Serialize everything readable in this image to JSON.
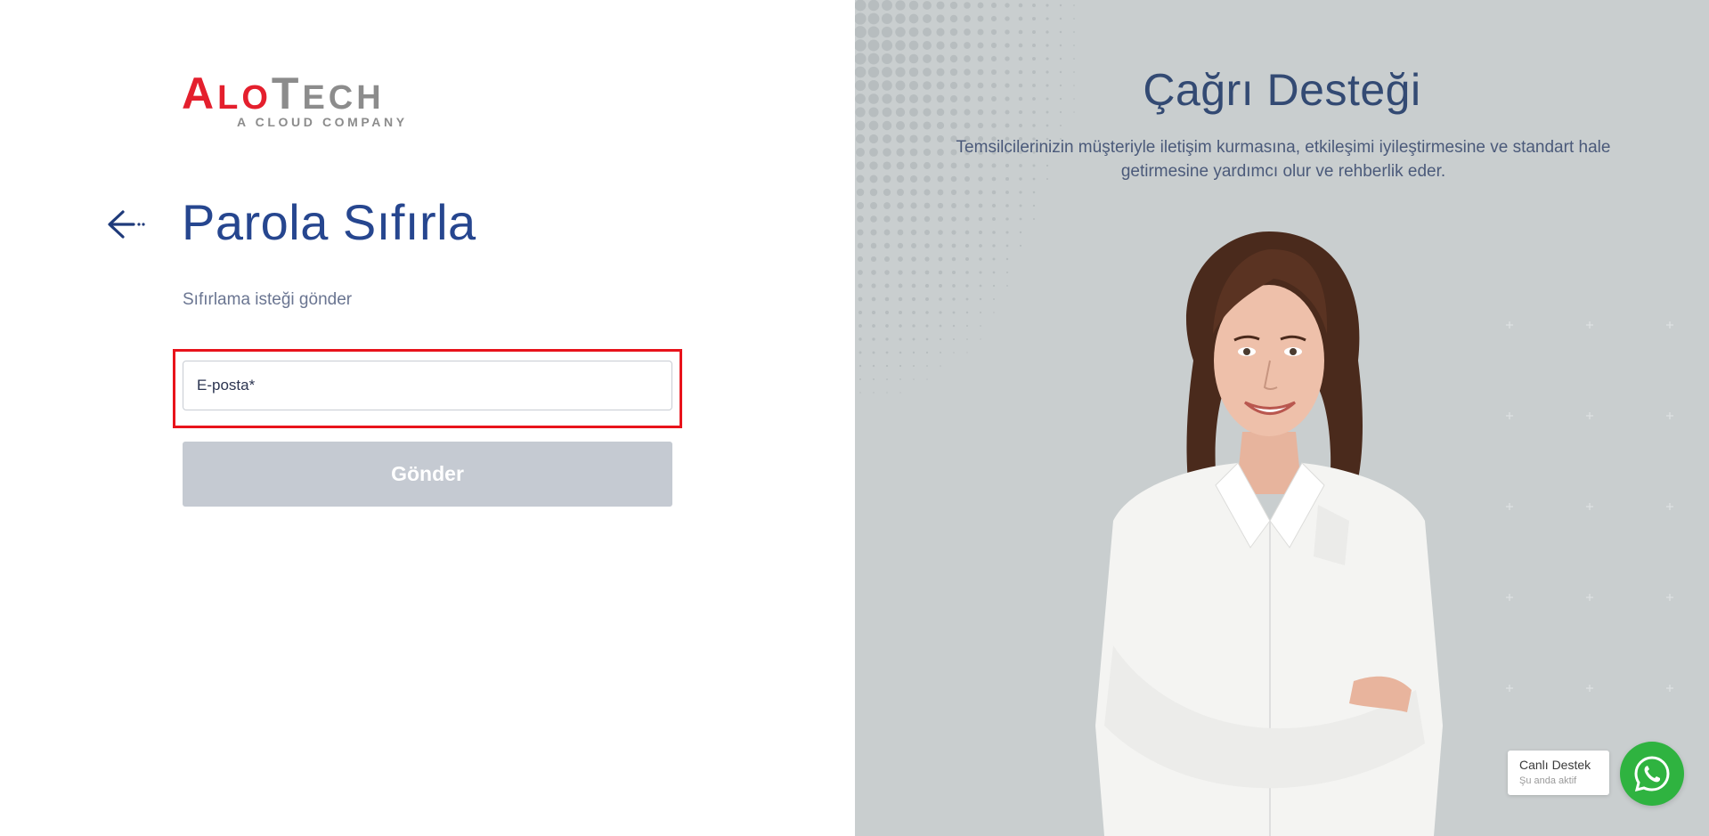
{
  "logo": {
    "main_initial_1": "A",
    "main_rest_1": "LO",
    "main_initial_2": "T",
    "main_rest_2": "ECH",
    "sub": "A CLOUD  COMPANY"
  },
  "form": {
    "title": "Parola Sıfırla",
    "subtitle": "Sıfırlama isteği gönder",
    "email_label": "E-posta*",
    "submit_label": "Gönder"
  },
  "promo": {
    "title": "Çağrı Desteği",
    "description": "Temsilcilerinizin müşteriyle iletişim kurmasına, etkileşimi iyileştirmesine ve standart hale getirmesine yardımcı olur ve rehberlik eder."
  },
  "live_chat": {
    "title": "Canlı Destek",
    "status": "Şu anda aktif"
  },
  "colors": {
    "brand_red": "#e41f2d",
    "brand_grey": "#8c8c8c",
    "title_blue": "#26468f",
    "button_disabled": "#c5cad2",
    "right_bg": "#c9cecf",
    "whatsapp_green": "#2fb340",
    "focus_ring": "#e8131b"
  },
  "icons": {
    "back": "arrow-left-icon",
    "chat": "whatsapp-icon"
  }
}
